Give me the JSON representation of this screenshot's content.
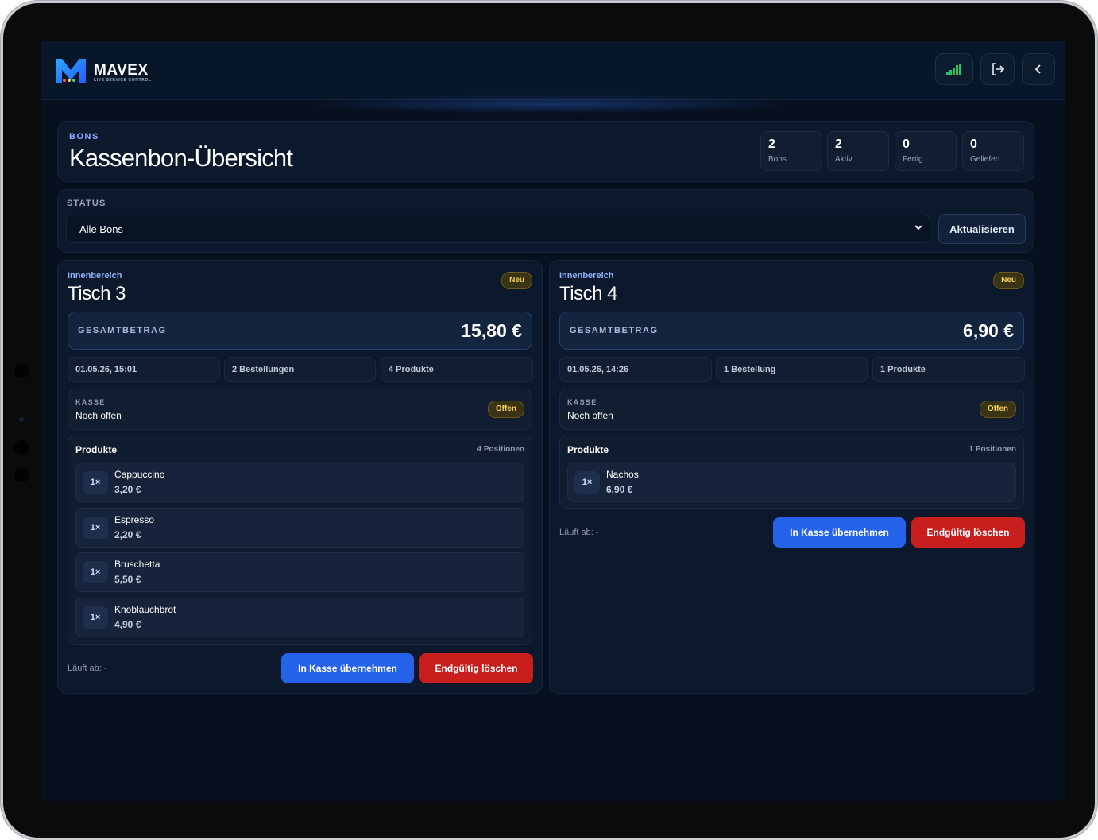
{
  "app": {
    "brand": "MAVEX",
    "brand_sub": "LIVE SERVICE CONTROL",
    "colors": {
      "accent": "#2563eb",
      "danger": "#c81e1e",
      "warn": "#f6d05a",
      "signal": "#22c55e"
    }
  },
  "header": {
    "eyebrow": "BONS",
    "title": "Kassenbon-Übersicht",
    "stats": [
      {
        "value": "2",
        "label": "Bons"
      },
      {
        "value": "2",
        "label": "Aktiv"
      },
      {
        "value": "0",
        "label": "Fertig"
      },
      {
        "value": "0",
        "label": "Geliefert"
      }
    ]
  },
  "toolbar": {
    "icons": [
      "signal-icon",
      "logout-icon",
      "chevron-left-icon"
    ]
  },
  "filter": {
    "label": "STATUS",
    "selected": "Alle Bons",
    "refresh_label": "Aktualisieren"
  },
  "bons": [
    {
      "area": "Innenbereich",
      "table": "Tisch 3",
      "badge": "Neu",
      "total_label": "GESAMTBETRAG",
      "total": "15,80 €",
      "date": "01.05.26, 15:01",
      "orders": "2 Bestellungen",
      "products_count": "4 Produkte",
      "kasse_label": "KASSE",
      "kasse_status": "Noch offen",
      "kasse_badge": "Offen",
      "products_title": "Produkte",
      "positions": "4 Positionen",
      "items": [
        {
          "qty": "1×",
          "name": "Cappuccino",
          "price": "3,20 €"
        },
        {
          "qty": "1×",
          "name": "Espresso",
          "price": "2,20 €"
        },
        {
          "qty": "1×",
          "name": "Bruschetta",
          "price": "5,50 €"
        },
        {
          "qty": "1×",
          "name": "Knoblauchbrot",
          "price": "4,90 €"
        }
      ],
      "expires": "Läuft ab: -",
      "btn_kasse": "In Kasse übernehmen",
      "btn_delete": "Endgültig löschen"
    },
    {
      "area": "Innenbereich",
      "table": "Tisch 4",
      "badge": "Neu",
      "total_label": "GESAMTBETRAG",
      "total": "6,90 €",
      "date": "01.05.26, 14:26",
      "orders": "1 Bestellung",
      "products_count": "1 Produkte",
      "kasse_label": "KASSE",
      "kasse_status": "Noch offen",
      "kasse_badge": "Offen",
      "products_title": "Produkte",
      "positions": "1 Positionen",
      "items": [
        {
          "qty": "1×",
          "name": "Nachos",
          "price": "6,90 €"
        }
      ],
      "expires": "Läuft ab: -",
      "btn_kasse": "In Kasse übernehmen",
      "btn_delete": "Endgültig löschen"
    }
  ]
}
